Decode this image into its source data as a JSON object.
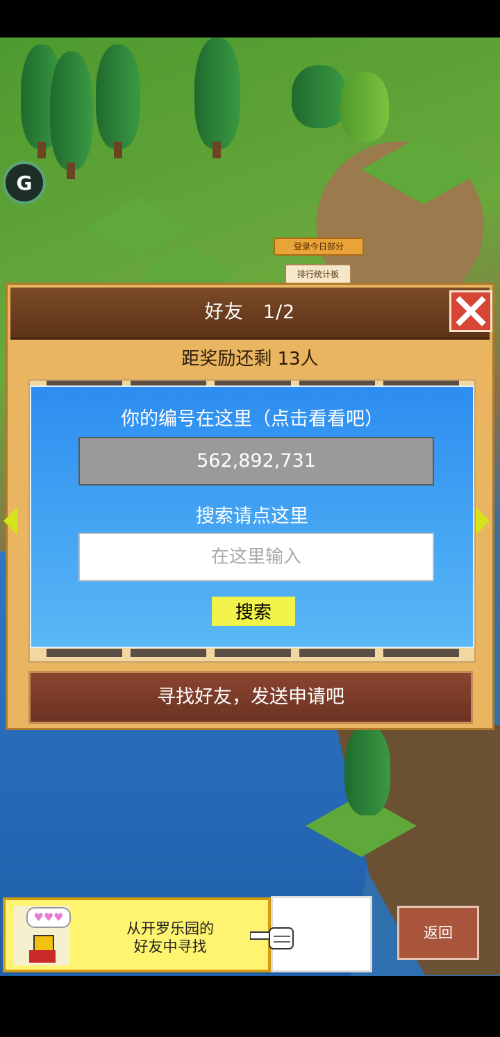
{
  "map": {
    "login_tag": "登录今日部分",
    "rank_board": "排行统计板"
  },
  "dialog": {
    "title": "好友　1/2",
    "remaining": "距奖励还剩 13人",
    "your_id_label": "你的编号在这里（点击看看吧）",
    "your_id": "562,892,731",
    "search_label": "搜索请点这里",
    "search_placeholder": "在这里输入",
    "search_button": "搜索",
    "find_friends_button": "寻找好友，发送申请吧"
  },
  "banner": {
    "text_line1": "从开罗乐园的",
    "text_line2": "好友中寻找",
    "bubble": "♥♥♥"
  },
  "back_button": "返回",
  "colors": {
    "accent_yellow": "#f2f34a",
    "panel_blue": "#2d8df0",
    "close_red": "#d64535",
    "header_brown": "#7b4a26"
  }
}
